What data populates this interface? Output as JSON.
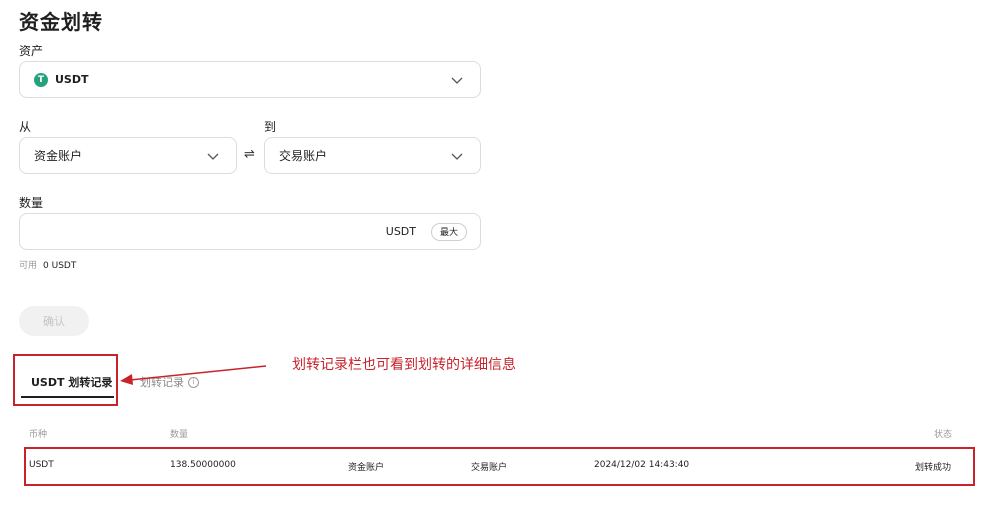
{
  "page_title": "资金划转",
  "asset": {
    "label": "资产",
    "coin_icon_letter": "T",
    "coin": "USDT",
    "coin_color": "#26a17b"
  },
  "from": {
    "label": "从",
    "value": "资金账户"
  },
  "swap_symbol": "⇌",
  "to": {
    "label": "到",
    "value": "交易账户"
  },
  "amount": {
    "label": "数量",
    "value": "",
    "placeholder": "",
    "unit": "USDT",
    "max_label": "最大"
  },
  "available": {
    "label": "可用",
    "value": "0 USDT"
  },
  "confirm_label": "确认",
  "tabs": [
    {
      "label": "USDT 划转记录",
      "active": true
    },
    {
      "label": "划转记录",
      "active": false
    }
  ],
  "annotation": {
    "text": "划转记录栏也可看到划转的详细信息",
    "color": "#c8232c"
  },
  "table": {
    "headers": {
      "coin": "币种",
      "amount": "数量",
      "status": "状态"
    },
    "rows": [
      {
        "coin": "USDT",
        "amount": "138.50000000",
        "from": "资金账户",
        "to": "交易账户",
        "time": "2024/12/02 14:43:40",
        "status": "划转成功"
      }
    ]
  }
}
